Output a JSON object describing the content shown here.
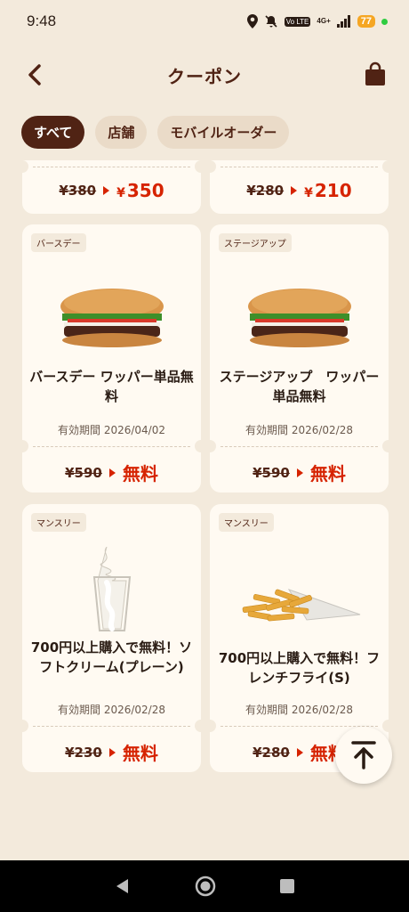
{
  "status": {
    "time": "9:48",
    "volte": "Vo LTE",
    "network": "4G+",
    "battery": "77"
  },
  "header": {
    "title": "クーポン"
  },
  "tabs": [
    {
      "label": "すべて",
      "active": true
    },
    {
      "label": "店舗",
      "active": false
    },
    {
      "label": "モバイルオーダー",
      "active": false
    }
  ],
  "coupons": [
    {
      "old_price": "¥380",
      "yen": "¥",
      "new_price": "350"
    },
    {
      "old_price": "¥280",
      "yen": "¥",
      "new_price": "210"
    },
    {
      "badge": "バースデー",
      "title": "バースデー ワッパー単品無料",
      "expiry": "有効期間 2026/04/02",
      "old_price": "¥590",
      "new_price": "無料",
      "image": "whopper-icon"
    },
    {
      "badge": "ステージアップ",
      "title": "ステージアップ　ワッパー単品無料",
      "expiry": "有効期間 2026/02/28",
      "old_price": "¥590",
      "new_price": "無料",
      "image": "whopper-icon"
    },
    {
      "badge": "マンスリー",
      "title": "700円以上購入で無料！ソフトクリーム(プレーン)",
      "expiry": "有効期間 2026/02/28",
      "old_price": "¥230",
      "new_price": "無料",
      "image": "soft-cream-icon"
    },
    {
      "badge": "マンスリー",
      "title": "700円以上購入で無料！フレンチフライ(S)",
      "expiry": "有効期間 2026/02/28",
      "old_price": "¥280",
      "new_price": "無料",
      "image": "french-fries-icon"
    }
  ],
  "colors": {
    "brand_brown": "#502314",
    "price_red": "#d62300",
    "background": "#f3eadc",
    "card": "#fffaf2"
  }
}
